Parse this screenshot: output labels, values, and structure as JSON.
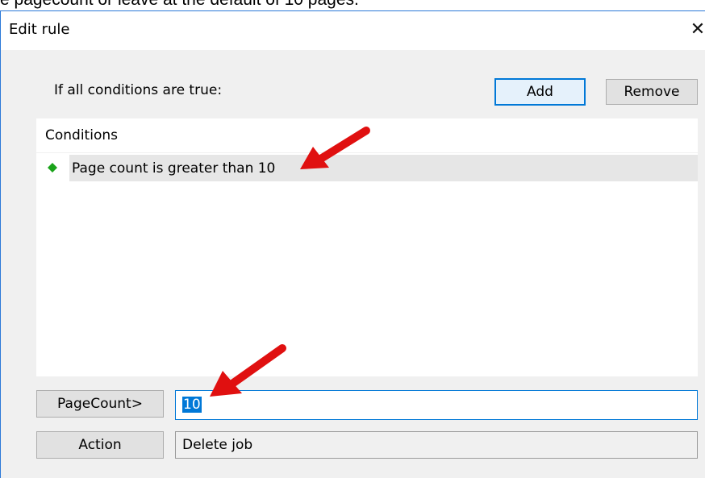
{
  "caption_text": "e pagecount or leave at the default of 10 pages.",
  "dialog": {
    "title": "Edit rule",
    "close_glyph": "✕"
  },
  "conditions_bar": {
    "label": "If all conditions are true:",
    "add_label": "Add",
    "remove_label": "Remove"
  },
  "conditions_list": {
    "header": "Conditions",
    "items": [
      {
        "text": "Page count is greater than 10",
        "icon": "green-diamond-icon",
        "selected": true
      }
    ]
  },
  "pagecount": {
    "button_label": "PageCount>",
    "value": "10"
  },
  "action": {
    "button_label": "Action",
    "value": "Delete job"
  },
  "colors": {
    "accent": "#0078d7",
    "diamond": "#1aa31a",
    "annotation_arrow": "#e01010"
  }
}
